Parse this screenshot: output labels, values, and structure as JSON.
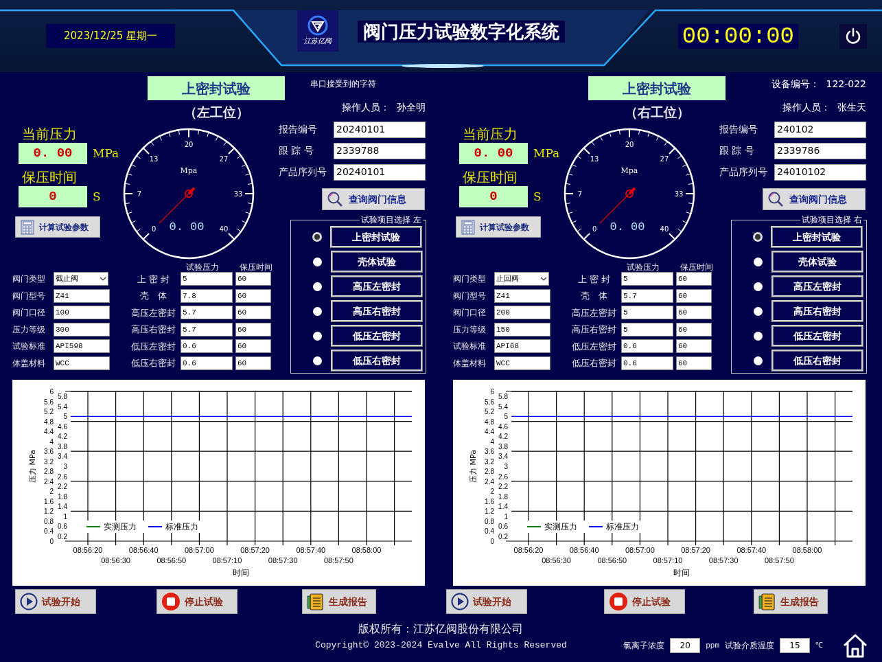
{
  "header": {
    "date": "2023/12/25 星期一",
    "logo_text": "江苏亿阀",
    "title": "阀门压力试验数字化系统",
    "timer": "00:00:00"
  },
  "stations": [
    {
      "test_title": "上密封试验",
      "position": "（左工位）",
      "top_lines": [
        {
          "kind": "note",
          "text": "串口接受到的字符"
        },
        {
          "kind": "pair",
          "label": "操作人员：",
          "value": "孙全明"
        }
      ],
      "pressure_label": "当前压力",
      "pressure": "0. 00",
      "pressure_unit": "MPa",
      "hold_label": "保压时间",
      "hold": "0",
      "hold_unit": "S",
      "calc_button": "计算试验参数",
      "gauge": {
        "scale": [
          "0",
          "7",
          "13",
          "20",
          "27",
          "33",
          "40"
        ],
        "unit": "Mpa",
        "reading": "0. 00"
      },
      "fields": [
        {
          "label": "报告编号",
          "value": "20240101"
        },
        {
          "label": "跟 踪 号",
          "value": "2339788"
        },
        {
          "label": "产品序列号",
          "value": "20240101"
        }
      ],
      "query_button": "查询阀门信息",
      "valve": [
        {
          "label": "阀门类型",
          "value": "截止阀",
          "kind": "select"
        },
        {
          "label": "阀门型号",
          "value": "Z41",
          "kind": "text"
        },
        {
          "label": "阀门口径",
          "value": "100",
          "kind": "text"
        },
        {
          "label": "压力等级",
          "value": "300",
          "kind": "text"
        },
        {
          "label": "试验标准",
          "value": "API598",
          "kind": "text"
        },
        {
          "label": "体盖材料",
          "value": "WCC",
          "kind": "text"
        }
      ],
      "test_headers": [
        "试验压力",
        "保压时间"
      ],
      "tests": [
        {
          "label": "上 密 封",
          "pressure": "5",
          "time": "60"
        },
        {
          "label": "壳　体",
          "pressure": "7.8",
          "time": "60"
        },
        {
          "label": "高压左密封",
          "pressure": "5.7",
          "time": "60"
        },
        {
          "label": "高压右密封",
          "pressure": "5.7",
          "time": "60"
        },
        {
          "label": "低压左密封",
          "pressure": "0.6",
          "time": "60"
        },
        {
          "label": "低压右密封",
          "pressure": "0.6",
          "time": "60"
        }
      ],
      "selection": {
        "legend": "试验项目选择 左",
        "items": [
          {
            "label": "上密封试验",
            "selected": true
          },
          {
            "label": "壳体试验",
            "selected": false
          },
          {
            "label": "高压左密封",
            "selected": false
          },
          {
            "label": "高压右密封",
            "selected": false
          },
          {
            "label": "低压左密封",
            "selected": false
          },
          {
            "label": "低压右密封",
            "selected": false
          }
        ]
      },
      "chart_data": {
        "type": "line",
        "xlabel": "时间",
        "ylabel": "压力 MPa",
        "categories": [
          "08:56:20",
          "08:56:30",
          "08:56:40",
          "08:56:50",
          "08:57:00",
          "08:57:10",
          "08:57:20",
          "08:57:30",
          "08:57:40",
          "08:57:50",
          "08:58:00"
        ],
        "ylim": [
          0,
          6
        ],
        "grid": true,
        "yticks": [
          0,
          0.4,
          0.8,
          1.2,
          1.6,
          2,
          2.4,
          2.8,
          3.2,
          3.6,
          4,
          4.4,
          4.8,
          5.2,
          5.6,
          6
        ],
        "series": [
          {
            "name": "实测压力",
            "color": "#008000",
            "values": [
              null,
              null,
              null,
              null,
              null,
              null,
              null,
              null,
              null,
              null,
              null
            ]
          },
          {
            "name": "标准压力",
            "color": "#0000ff",
            "values": [
              5,
              5,
              5,
              5,
              5,
              5,
              5,
              5,
              5,
              5,
              5
            ]
          }
        ]
      },
      "secondary_axis_labels": [
        "5.8",
        "5.4",
        "5",
        "4.6",
        "4.2",
        "3.8",
        "3.4",
        "3",
        "2.6",
        "2.2",
        "1.8",
        "1.4",
        "1",
        "0.6",
        "0.2"
      ],
      "buttons": [
        {
          "kind": "start",
          "label": "试验开始"
        },
        {
          "kind": "stop",
          "label": "停止试验"
        },
        {
          "kind": "report",
          "label": "生成报告"
        }
      ]
    },
    {
      "test_title": "上密封试验",
      "position": "（右工位）",
      "top_lines": [
        {
          "kind": "pair",
          "label": "设备编号：",
          "value": "122-022"
        },
        {
          "kind": "pair",
          "label": "操作人员：",
          "value": "张生天"
        }
      ],
      "pressure_label": "当前压力",
      "pressure": "0. 00",
      "pressure_unit": "MPa",
      "hold_label": "保压时间",
      "hold": "0",
      "hold_unit": "S",
      "calc_button": "计算试验参数",
      "gauge": {
        "scale": [
          "0",
          "7",
          "13",
          "20",
          "27",
          "33",
          "40"
        ],
        "unit": "Mpa",
        "reading": "0. 00"
      },
      "fields": [
        {
          "label": "报告编号",
          "value": "240102"
        },
        {
          "label": "跟 踪 号",
          "value": "2339786"
        },
        {
          "label": "产品序列号",
          "value": "24010102"
        }
      ],
      "query_button": "查询阀门信息",
      "valve": [
        {
          "label": "阀门类型",
          "value": "止回阀",
          "kind": "select"
        },
        {
          "label": "阀门型号",
          "value": "Z41",
          "kind": "text"
        },
        {
          "label": "阀门口径",
          "value": "200",
          "kind": "text"
        },
        {
          "label": "压力等级",
          "value": "150",
          "kind": "text"
        },
        {
          "label": "试验标准",
          "value": "API68",
          "kind": "text"
        },
        {
          "label": "体盖材料",
          "value": "WCC",
          "kind": "text"
        }
      ],
      "test_headers": [
        "试验压力",
        "保压时间"
      ],
      "tests": [
        {
          "label": "上 密 封",
          "pressure": "5",
          "time": "60"
        },
        {
          "label": "壳　体",
          "pressure": "5.7",
          "time": "60"
        },
        {
          "label": "高压左密封",
          "pressure": "5",
          "time": "60"
        },
        {
          "label": "高压右密封",
          "pressure": "5",
          "time": "60"
        },
        {
          "label": "低压左密封",
          "pressure": "0.6",
          "time": "60"
        },
        {
          "label": "低压右密封",
          "pressure": "0.6",
          "time": "60"
        }
      ],
      "selection": {
        "legend": "试验项目选择 右",
        "items": [
          {
            "label": "上密封试验",
            "selected": true
          },
          {
            "label": "壳体试验",
            "selected": false
          },
          {
            "label": "高压左密封",
            "selected": false
          },
          {
            "label": "高压右密封",
            "selected": false
          },
          {
            "label": "低压左密封",
            "selected": false
          },
          {
            "label": "低压右密封",
            "selected": false
          }
        ]
      },
      "chart_data": {
        "type": "line",
        "xlabel": "时间",
        "ylabel": "压力 MPa",
        "categories": [
          "08:56:20",
          "08:56:30",
          "08:56:40",
          "08:56:50",
          "08:57:00",
          "08:57:10",
          "08:57:20",
          "08:57:30",
          "08:57:40",
          "08:57:50",
          "08:58:00"
        ],
        "ylim": [
          0,
          6
        ],
        "grid": true,
        "yticks": [
          0,
          0.4,
          0.8,
          1.2,
          1.6,
          2,
          2.4,
          2.8,
          3.2,
          3.6,
          4,
          4.4,
          4.8,
          5.2,
          5.6,
          6
        ],
        "series": [
          {
            "name": "实测压力",
            "color": "#008000",
            "values": [
              null,
              null,
              null,
              null,
              null,
              null,
              null,
              null,
              null,
              null,
              null
            ]
          },
          {
            "name": "标准压力",
            "color": "#0000ff",
            "values": [
              5,
              5,
              5,
              5,
              5,
              5,
              5,
              5,
              5,
              5,
              5
            ]
          }
        ]
      },
      "secondary_axis_labels": [
        "5.8",
        "5.4",
        "5",
        "4.6",
        "4.2",
        "3.8",
        "3.4",
        "3",
        "2.6",
        "2.2",
        "1.8",
        "1.4",
        "1",
        "0.6",
        "0.2"
      ],
      "buttons": [
        {
          "kind": "start",
          "label": "试验开始"
        },
        {
          "kind": "stop",
          "label": "停止试验"
        },
        {
          "kind": "report",
          "label": "生成报告"
        }
      ]
    }
  ],
  "footer": {
    "copyright": "版权所有：江苏亿阀股份有限公司",
    "copyright_en": "Copyright© 2023-2024 Evalve All Rights Reserved",
    "settings": [
      {
        "label": "氯离子浓度",
        "value": "20",
        "unit": "ppm"
      },
      {
        "label": "试验介质温度",
        "value": "15",
        "unit": "℃"
      }
    ]
  }
}
